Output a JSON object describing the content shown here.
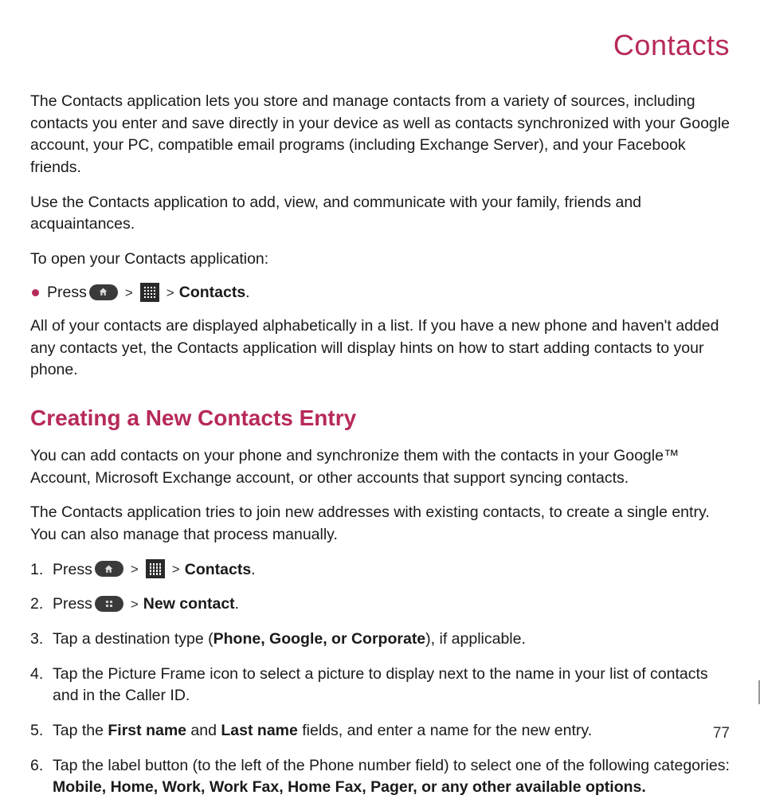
{
  "header": {
    "title": "Contacts"
  },
  "intro": {
    "p1": "The Contacts application lets you store and manage contacts from a variety of sources, including contacts you enter and save directly in your device as well as contacts synchronized with your Google account, your PC, compatible email programs (including Exchange Server), and your Facebook friends.",
    "p2": "Use the Contacts application to add, view, and communicate with your family, friends and acquaintances.",
    "p3": "To open your Contacts application:",
    "bullet_press": "Press",
    "bullet_contacts": "Contacts",
    "p4": "All of your contacts are displayed alphabetically in a list. If you have a new phone and haven't added any contacts yet, the Contacts application will display hints on how to start adding contacts to your phone."
  },
  "section": {
    "title": "Creating a New Contacts Entry",
    "p1": "You can add contacts on your phone and synchronize them with the contacts in your Google™ Account, Microsoft Exchange account, or other accounts that support syncing contacts.",
    "p2": "The Contacts application tries to join new addresses with existing contacts, to create a single entry. You can also manage that process manually."
  },
  "steps": {
    "s1_num": "1.",
    "s1_press": "Press",
    "s1_contacts": "Contacts",
    "s2_num": "2.",
    "s2_press": "Press",
    "s2_newcontact": "New contact",
    "s3_num": "3.",
    "s3_a": "Tap a destination type (",
    "s3_b": "Phone, Google, or Corporate",
    "s3_c": "), if applicable.",
    "s4_num": "4.",
    "s4": "Tap the Picture Frame icon to select a picture to display next to the name in your list of contacts and in the Caller ID.",
    "s5_num": "5.",
    "s5_a": "Tap the ",
    "s5_b": "First name",
    "s5_c": " and ",
    "s5_d": "Last name",
    "s5_e": " fields, and enter a name for the new entry.",
    "s6_num": "6.",
    "s6_a": "Tap the label button (to the left of the Phone number field) to select one of the following categories: ",
    "s6_b": "Mobile, Home, Work, Work Fax, Home Fax, Pager, or any other available options."
  },
  "separator": ">",
  "page_number": "77"
}
